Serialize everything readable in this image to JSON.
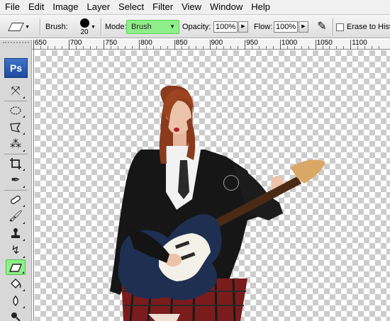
{
  "menu": [
    "File",
    "Edit",
    "Image",
    "Layer",
    "Select",
    "Filter",
    "View",
    "Window",
    "Help"
  ],
  "options": {
    "brush_label": "Brush:",
    "brush_size": "20",
    "mode_label": "Mode:",
    "mode_value": "Brush",
    "opacity_label": "Opacity:",
    "opacity_value": "100%",
    "flow_label": "Flow:",
    "flow_value": "100%",
    "erase_history_label": "Erase to Histor"
  },
  "toolbox": {
    "logo": "Ps",
    "tools": [
      {
        "name": "move-tool",
        "icon": "move-icon"
      },
      {
        "name": "marquee-tool",
        "icon": "elliptical-marquee-icon"
      },
      {
        "name": "lasso-tool",
        "icon": "polygonal-lasso-icon"
      },
      {
        "name": "magic-wand-tool",
        "icon": "magic-wand-icon"
      },
      {
        "name": "crop-tool",
        "icon": "crop-icon"
      },
      {
        "name": "eyedropper-tool",
        "icon": "eyedropper-icon"
      },
      {
        "name": "healing-brush-tool",
        "icon": "bandage-icon"
      },
      {
        "name": "brush-tool",
        "icon": "brush-icon"
      },
      {
        "name": "clone-stamp-tool",
        "icon": "stamp-icon"
      },
      {
        "name": "history-brush-tool",
        "icon": "history-brush-icon"
      },
      {
        "name": "eraser-tool",
        "icon": "eraser-icon",
        "active": true
      },
      {
        "name": "paint-bucket-tool",
        "icon": "paint-bucket-icon"
      },
      {
        "name": "blur-tool",
        "icon": "blur-icon"
      },
      {
        "name": "dodge-tool",
        "icon": "dodge-icon"
      },
      {
        "name": "pen-tool",
        "icon": "pen-icon"
      }
    ]
  },
  "ruler": {
    "labels": [
      "650",
      "700",
      "750",
      "800",
      "850",
      "900",
      "950",
      "1000",
      "1050",
      "1100"
    ]
  },
  "colors": {
    "highlight": "#8ff08a",
    "ps_logo": "#2a5db0",
    "checker": "#cccccc"
  }
}
